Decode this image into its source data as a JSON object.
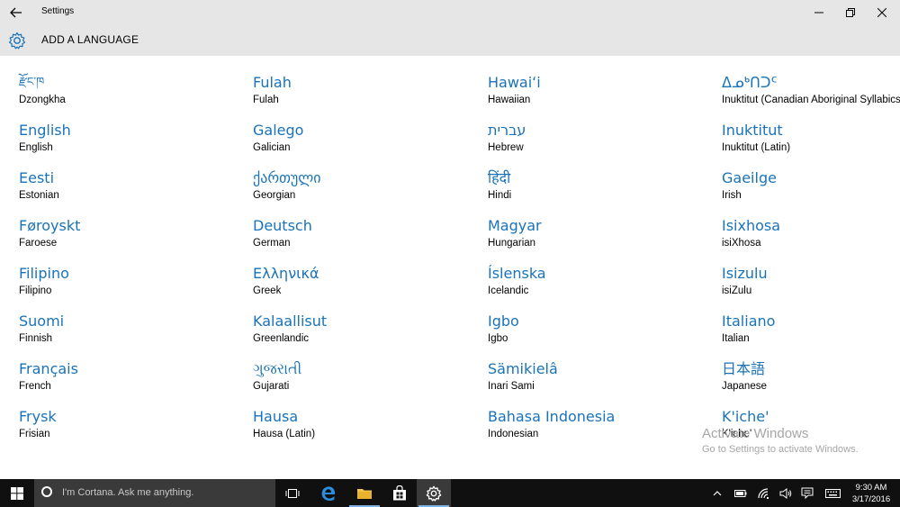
{
  "window": {
    "title": "Settings",
    "header_title": "ADD A LANGUAGE",
    "accent_color": "#1a73b8"
  },
  "languages": [
    [
      {
        "native": "རྫོང་ཁ",
        "english": "Dzongkha"
      },
      {
        "native": "English",
        "english": "English"
      },
      {
        "native": "Eesti",
        "english": "Estonian"
      },
      {
        "native": "Føroyskt",
        "english": "Faroese"
      },
      {
        "native": "Filipino",
        "english": "Filipino"
      },
      {
        "native": "Suomi",
        "english": "Finnish"
      },
      {
        "native": "Français",
        "english": "French"
      },
      {
        "native": "Frysk",
        "english": "Frisian"
      }
    ],
    [
      {
        "native": "Fulah",
        "english": "Fulah"
      },
      {
        "native": "Galego",
        "english": "Galician"
      },
      {
        "native": "ქართული",
        "english": "Georgian"
      },
      {
        "native": "Deutsch",
        "english": "German"
      },
      {
        "native": "Ελληνικά",
        "english": "Greek"
      },
      {
        "native": "Kalaallisut",
        "english": "Greenlandic"
      },
      {
        "native": "ગુજરાતી",
        "english": "Gujarati"
      },
      {
        "native": "Hausa",
        "english": "Hausa (Latin)"
      }
    ],
    [
      {
        "native": "Hawaiʻi",
        "english": "Hawaiian"
      },
      {
        "native": "עברית",
        "english": "Hebrew"
      },
      {
        "native": "हिंदी",
        "english": "Hindi"
      },
      {
        "native": "Magyar",
        "english": "Hungarian"
      },
      {
        "native": "Íslenska",
        "english": "Icelandic"
      },
      {
        "native": "Igbo",
        "english": "Igbo"
      },
      {
        "native": "Sämikielâ",
        "english": "Inari Sami"
      },
      {
        "native": "Bahasa Indonesia",
        "english": "Indonesian"
      }
    ],
    [
      {
        "native": "ᐃᓄᒃᑎᑐᑦ",
        "english": "Inuktitut (Canadian Aboriginal Syllabics)"
      },
      {
        "native": "Inuktitut",
        "english": "Inuktitut (Latin)"
      },
      {
        "native": "Gaeilge",
        "english": "Irish"
      },
      {
        "native": "Isixhosa",
        "english": "isiXhosa"
      },
      {
        "native": "Isizulu",
        "english": "isiZulu"
      },
      {
        "native": "Italiano",
        "english": "Italian"
      },
      {
        "native": "日本語",
        "english": "Japanese"
      },
      {
        "native": "K'iche'",
        "english": "K'iche'"
      }
    ]
  ],
  "watermark": {
    "line1": "Activate Windows",
    "line2": "Go to Settings to activate Windows."
  },
  "taskbar": {
    "cortana_placeholder": "I'm Cortana. Ask me anything.",
    "icons": [
      "task-view-icon",
      "edge-icon",
      "file-explorer-icon",
      "store-icon",
      "settings-icon"
    ],
    "time": "9:30 AM",
    "date": "3/17/2016"
  }
}
